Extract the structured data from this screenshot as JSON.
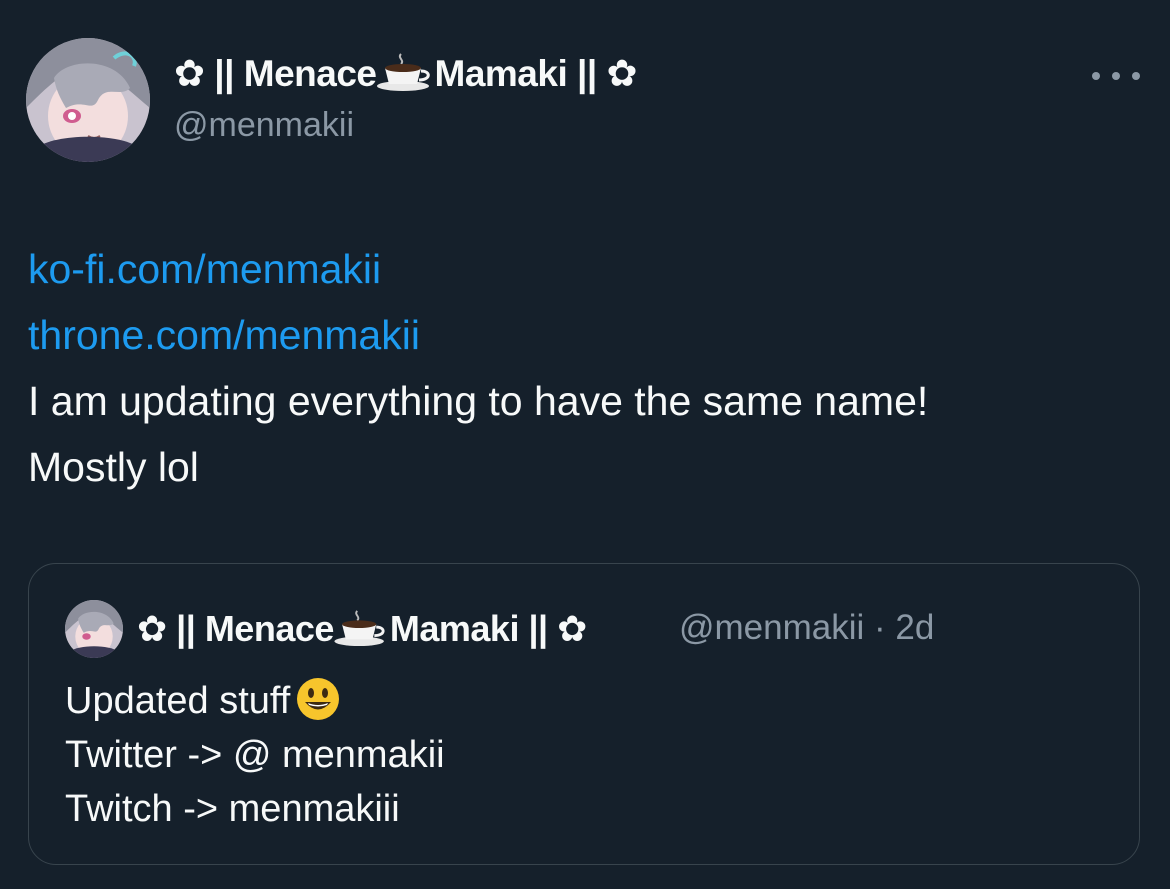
{
  "tweet": {
    "name_prefix": "✿ || Menace",
    "name_suffix": "Mamaki || ✿",
    "handle": "@menmakii",
    "links": [
      "ko-fi.com/menmakii",
      "throne.com/menmakii"
    ],
    "text_lines": [
      "I am updating everything to have the same name!",
      "Mostly lol"
    ]
  },
  "quote": {
    "name_prefix": "✿ || Menace",
    "name_suffix": "Mamaki || ✿",
    "meta": "@menmakii · 2d",
    "line1": "Updated stuff",
    "line2": "Twitter -> @ menmakii",
    "line3": "Twitch -> menmakiii"
  },
  "icons": {
    "more": "more-options-icon",
    "cup": "hot-beverage-icon",
    "smiley": "grinning-face-icon"
  },
  "colors": {
    "background": "#15202b",
    "link": "#1d9bf0",
    "muted": "#8b98a5",
    "border": "#38444d"
  }
}
